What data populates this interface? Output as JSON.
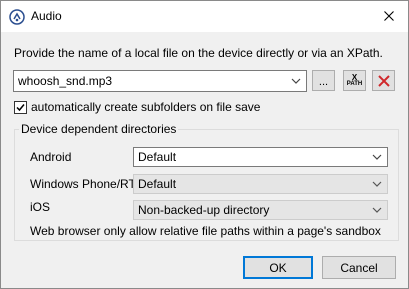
{
  "window": {
    "title": "Audio"
  },
  "instruction": "Provide the name of a local file on the device directly or via an XPath.",
  "file": {
    "value": "whoosh_snd.mp3",
    "browse_label": "...",
    "xpath_top": "X",
    "xpath_bottom": "PATH"
  },
  "subfolders": {
    "checked": true,
    "label": "automatically create subfolders on file save"
  },
  "group": {
    "title": "Device dependent directories",
    "rows": [
      {
        "label": "Android",
        "value": "Default",
        "enabled": true
      },
      {
        "label": "Windows Phone/RT",
        "value": "Default",
        "enabled": false
      },
      {
        "label": "iOS",
        "value": "Non-backed-up directory",
        "enabled": false
      }
    ],
    "note": "Web browser only allow relative file paths within a page's sandbox"
  },
  "buttons": {
    "ok": "OK",
    "cancel": "Cancel"
  },
  "colors": {
    "delete_red": "#d0282b",
    "default_button_border": "#0078d7"
  }
}
